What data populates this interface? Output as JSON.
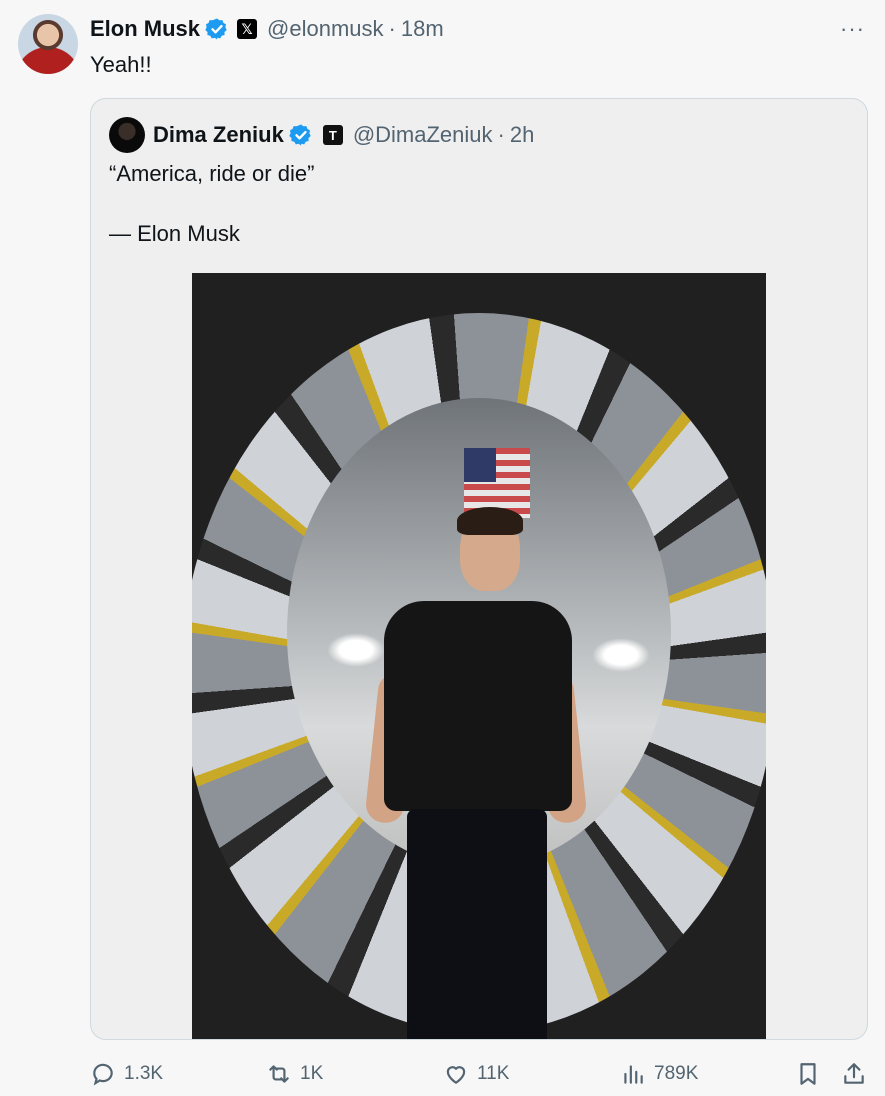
{
  "tweet": {
    "author_name": "Elon Musk",
    "x_badge": "𝕏",
    "handle": "@elonmusk",
    "separator": "·",
    "time": "18m",
    "more": "···",
    "text": "Yeah!!"
  },
  "quote": {
    "author_name": "Dima Zeniuk",
    "t_badge": "T",
    "handle": "@DimaZeniuk",
    "separator": "·",
    "time": "2h",
    "line1": "“America, ride or die”",
    "line2": "— Elon Musk"
  },
  "actions": {
    "replies": "1.3K",
    "reposts": "1K",
    "likes": "11K",
    "views": "789K"
  },
  "colors": {
    "verified": "#1d9bf0",
    "muted": "#536471"
  }
}
